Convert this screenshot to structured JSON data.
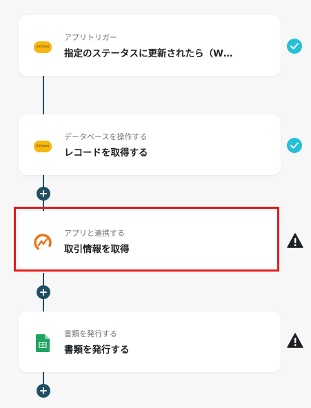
{
  "steps": [
    {
      "subtitle": "アプリトリガー",
      "title": "指定のステータスに更新されたら（W…",
      "icon": "kintone-icon",
      "icon_text": "kintone",
      "status": "check"
    },
    {
      "subtitle": "データベースを操作する",
      "title": "レコードを取得する",
      "icon": "kintone-icon",
      "icon_text": "kintone",
      "status": "check"
    },
    {
      "subtitle": "アプリと連携する",
      "title": "取引情報を取得",
      "icon": "moneyforward-icon",
      "status": "warning"
    },
    {
      "subtitle": "書類を発行する",
      "title": "書類を発行する",
      "icon": "google-sheets-icon",
      "status": "warning"
    }
  ],
  "colors": {
    "connector": "#1f4f63",
    "check": "#25c0d5",
    "warning": "#1c1f23",
    "highlight": "#e21b1b"
  }
}
